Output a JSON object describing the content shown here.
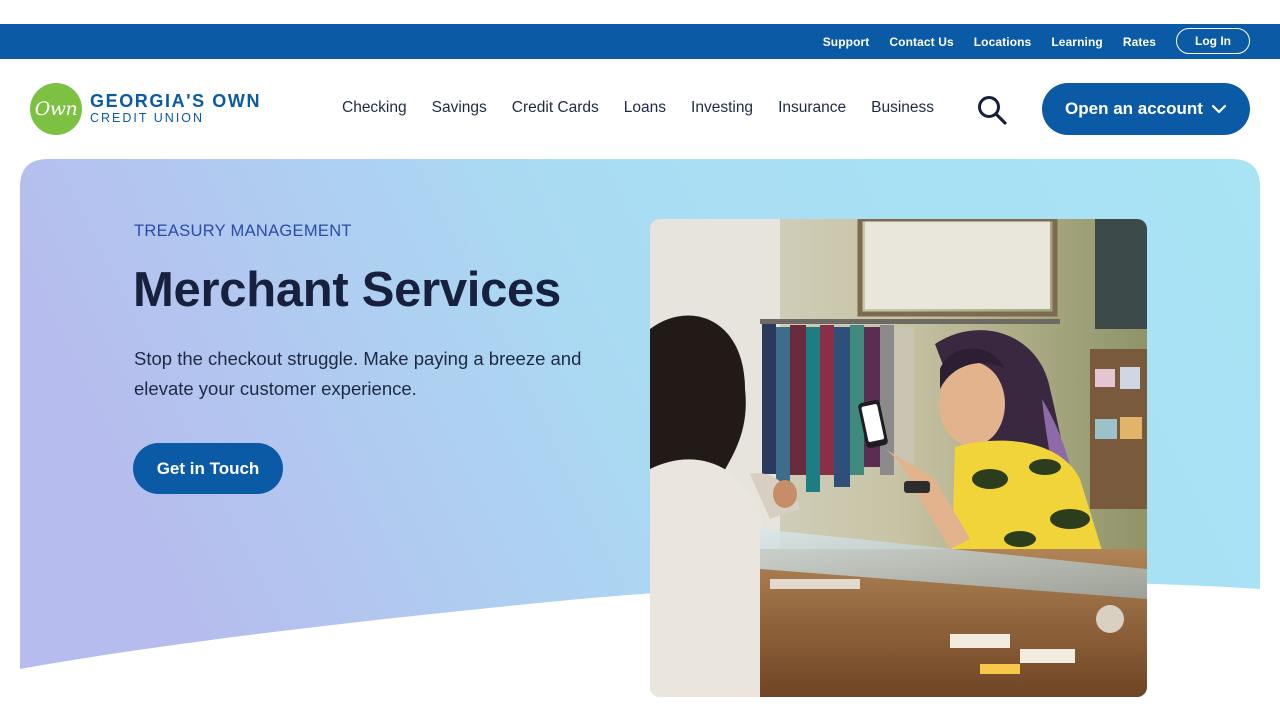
{
  "utility_nav": {
    "links": [
      "Support",
      "Contact Us",
      "Locations",
      "Learning",
      "Rates"
    ],
    "login_label": "Log In"
  },
  "brand": {
    "badge_text": "Own",
    "name_line1": "GEORGIA'S OWN",
    "name_line2": "CREDIT UNION",
    "color_primary": "#0a5aa5",
    "color_badge": "#7cc142"
  },
  "main_nav": {
    "items": [
      "Checking",
      "Savings",
      "Credit Cards",
      "Loans",
      "Investing",
      "Insurance",
      "Business"
    ],
    "search_icon": "search-icon",
    "cta_label": "Open an account",
    "cta_icon": "chevron-down-icon"
  },
  "hero": {
    "eyebrow": "TREASURY MANAGEMENT",
    "title": "Merchant Services",
    "description": "Stop the checkout struggle. Make paying a breeze and elevate your customer experience.",
    "cta_label": "Get in Touch",
    "gradient_start": "#b6bdee",
    "gradient_end": "#a8e4f4"
  }
}
